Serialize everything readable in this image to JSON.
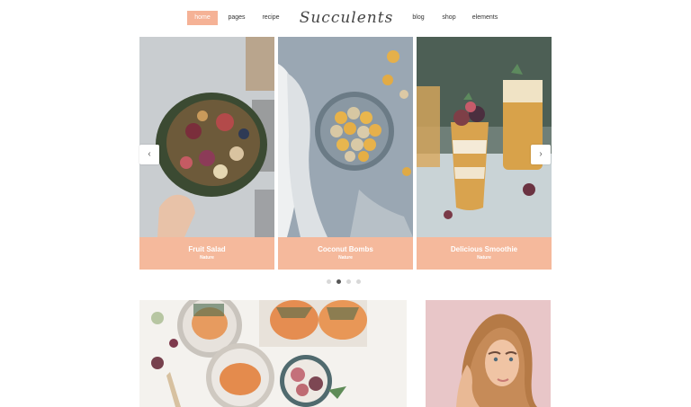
{
  "nav": {
    "items": [
      {
        "label": "home",
        "active": true
      },
      {
        "label": "pages",
        "active": false
      },
      {
        "label": "recipe",
        "active": false
      },
      {
        "label": "blog",
        "active": false
      },
      {
        "label": "shop",
        "active": false
      },
      {
        "label": "elements",
        "active": false
      }
    ],
    "logo": "Succulents"
  },
  "slider": {
    "cards": [
      {
        "title": "Fruit Salad",
        "tag": "Nature"
      },
      {
        "title": "Coconut Bombs",
        "tag": "Nature"
      },
      {
        "title": "Delicious Smoothie",
        "tag": "Nature"
      }
    ],
    "prev_icon": "‹",
    "next_icon": "›",
    "active_dot": 2,
    "dot_count": 4
  },
  "colors": {
    "accent": "#f5b296",
    "caption": "#f5b99c"
  }
}
